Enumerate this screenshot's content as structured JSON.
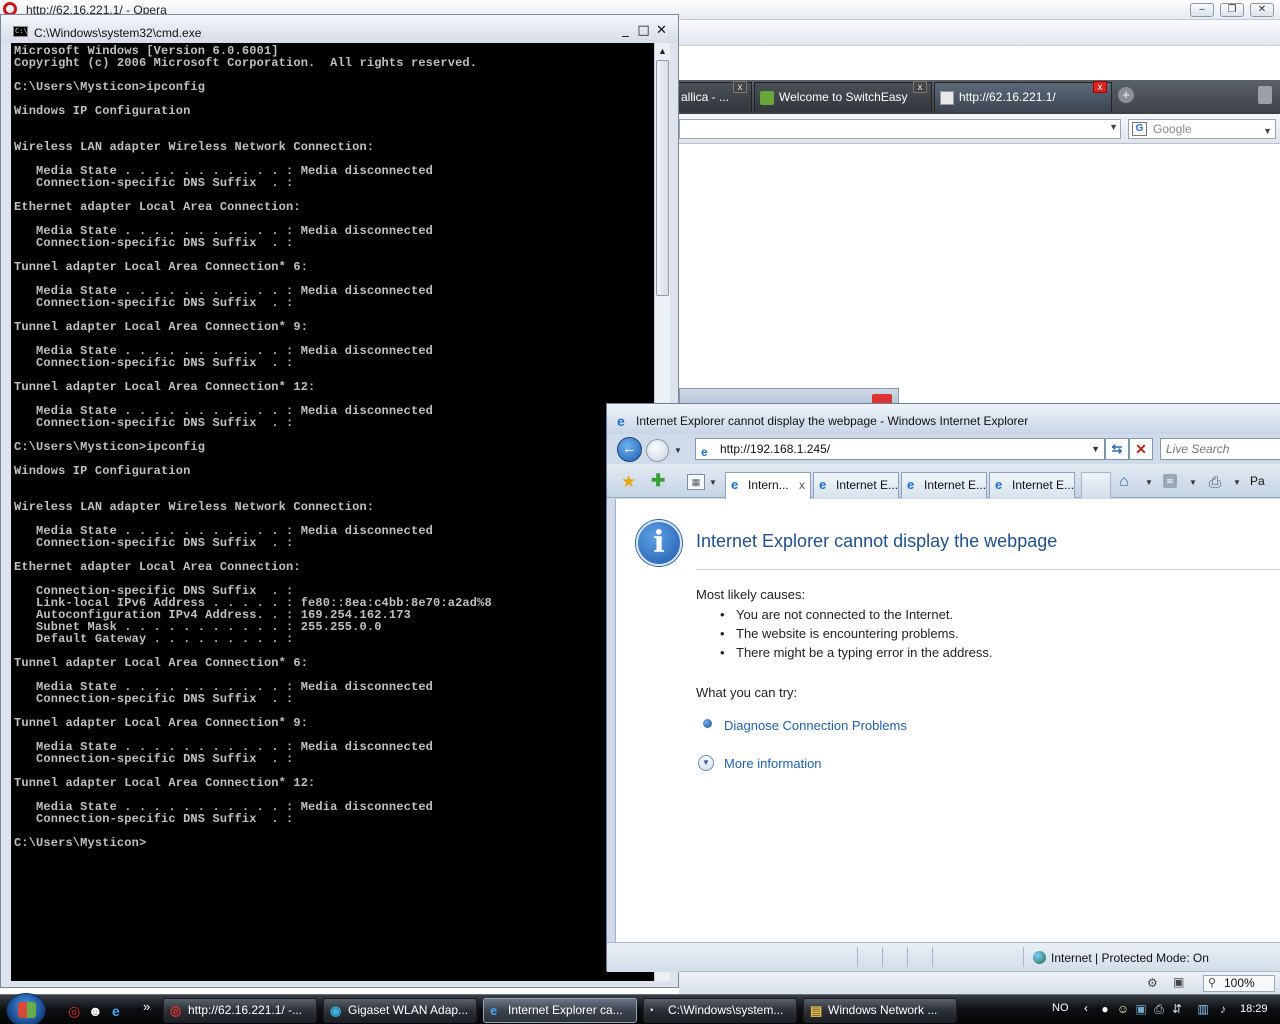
{
  "opera": {
    "title": "http://62.16.221.1/ - Opera",
    "window_controls": {
      "minimize": "–",
      "maximize": "❐",
      "close": "✕"
    },
    "tabs": [
      {
        "label": "allica - ..."
      },
      {
        "label": "Welcome to SwitchEasy"
      },
      {
        "label": "http://62.16.221.1/"
      }
    ],
    "search": {
      "placeholder": "Google"
    }
  },
  "cmd": {
    "title": "C:\\Windows\\system32\\cmd.exe",
    "icon_text": "C:\\",
    "window_controls": {
      "minimize": "_",
      "maximize": "□",
      "close": "✕"
    },
    "output": "Microsoft Windows [Version 6.0.6001]\nCopyright (c) 2006 Microsoft Corporation.  All rights reserved.\n\nC:\\Users\\Mysticon>ipconfig\n\nWindows IP Configuration\n\n\nWireless LAN adapter Wireless Network Connection:\n\n   Media State . . . . . . . . . . . : Media disconnected\n   Connection-specific DNS Suffix  . :\n\nEthernet adapter Local Area Connection:\n\n   Media State . . . . . . . . . . . : Media disconnected\n   Connection-specific DNS Suffix  . :\n\nTunnel adapter Local Area Connection* 6:\n\n   Media State . . . . . . . . . . . : Media disconnected\n   Connection-specific DNS Suffix  . :\n\nTunnel adapter Local Area Connection* 9:\n\n   Media State . . . . . . . . . . . : Media disconnected\n   Connection-specific DNS Suffix  . :\n\nTunnel adapter Local Area Connection* 12:\n\n   Media State . . . . . . . . . . . : Media disconnected\n   Connection-specific DNS Suffix  . :\n\nC:\\Users\\Mysticon>ipconfig\n\nWindows IP Configuration\n\n\nWireless LAN adapter Wireless Network Connection:\n\n   Media State . . . . . . . . . . . : Media disconnected\n   Connection-specific DNS Suffix  . :\n\nEthernet adapter Local Area Connection:\n\n   Connection-specific DNS Suffix  . :\n   Link-local IPv6 Address . . . . . : fe80::8ea:c4bb:8e70:a2ad%8\n   Autoconfiguration IPv4 Address. . : 169.254.162.173\n   Subnet Mask . . . . . . . . . . . : 255.255.0.0\n   Default Gateway . . . . . . . . . :\n\nTunnel adapter Local Area Connection* 6:\n\n   Media State . . . . . . . . . . . : Media disconnected\n   Connection-specific DNS Suffix  . :\n\nTunnel adapter Local Area Connection* 9:\n\n   Media State . . . . . . . . . . . : Media disconnected\n   Connection-specific DNS Suffix  . :\n\nTunnel adapter Local Area Connection* 12:\n\n   Media State . . . . . . . . . . . : Media disconnected\n   Connection-specific DNS Suffix  . :\n\nC:\\Users\\Mysticon>"
  },
  "ie": {
    "title": "Internet Explorer cannot display the webpage - Windows Internet Explorer",
    "address": "http://192.168.1.245/",
    "search_placeholder": "Live Search",
    "tabs": [
      {
        "label": "Intern..."
      },
      {
        "label": "Internet E..."
      },
      {
        "label": "Internet E..."
      },
      {
        "label": "Internet E..."
      }
    ],
    "toolbar_page_label": "Pa",
    "error": {
      "title": "Internet Explorer cannot display the webpage",
      "causes_heading": "Most likely causes:",
      "causes": [
        "You are not connected to the Internet.",
        "The website is encountering problems.",
        "There might be a typing error in the address."
      ],
      "try_heading": "What you can try:",
      "diagnose_link": "Diagnose Connection Problems",
      "more_info_link": "More information"
    },
    "status": {
      "zone": "Internet | Protected Mode: On"
    },
    "zoom": "100%"
  },
  "taskbar": {
    "buttons": [
      {
        "label": "http://62.16.221.1/ -..."
      },
      {
        "label": "Gigaset WLAN Adap..."
      },
      {
        "label": "Internet Explorer ca..."
      },
      {
        "label": "C:\\Windows\\system..."
      },
      {
        "label": "Windows Network ..."
      }
    ],
    "language": "NO",
    "clock": "18:29"
  },
  "colors": {
    "console_bg": "#000000",
    "console_text": "#c0c0c0",
    "ie_link": "#1f5fb0",
    "ie_error_title": "#1f4f8f"
  }
}
